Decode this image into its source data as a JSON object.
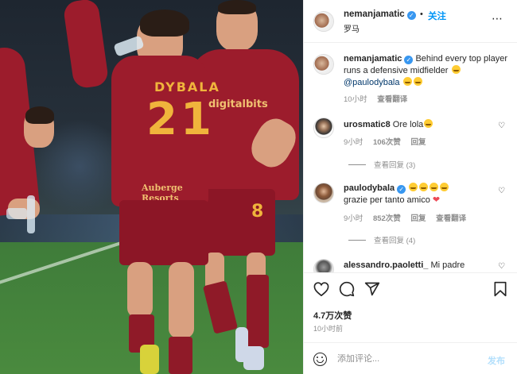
{
  "photo": {
    "left_player": {
      "shirt_name": "DYBALA",
      "shirt_number": "21",
      "sponsor": "Auberge Resorts"
    },
    "right_player": {
      "sponsor": "digitalbits",
      "shorts_number": "8"
    }
  },
  "header": {
    "username": "nemanjamatic",
    "separator": "•",
    "follow_label": "关注",
    "location": "罗马",
    "more_icon": "⋯"
  },
  "caption": {
    "username": "nemanjamatic",
    "text": "Behind every top player runs a defensive midfielder",
    "mention": "@paulodybala",
    "time": "10小时",
    "translate": "查看翻译"
  },
  "comments": [
    {
      "username": "urosmatic8",
      "text": "Ore lola",
      "time": "9小时",
      "likes": "106次赞",
      "reply": "回复",
      "view_replies": "查看回复 (3)"
    },
    {
      "username": "paulodybala",
      "text": "grazie per tanto amico",
      "time": "9小时",
      "likes": "852次赞",
      "reply": "回复",
      "translate": "查看翻译",
      "view_replies": "查看回复 (4)"
    },
    {
      "username": "alessandro.paoletti_",
      "text": "Mi padre"
    }
  ],
  "actions": {
    "likes": "4.7万次赞",
    "time_ago": "10小时前"
  },
  "add_comment": {
    "placeholder": "添加评论...",
    "post_label": "发布"
  },
  "colors": {
    "accent": "#0095f6",
    "jersey": "#9c1c2c",
    "jersey_text": "#f0b43c"
  },
  "icons": [
    "heart-icon",
    "comment-icon",
    "share-icon",
    "bookmark-icon",
    "emoji-icon",
    "verified-icon",
    "more-icon"
  ]
}
